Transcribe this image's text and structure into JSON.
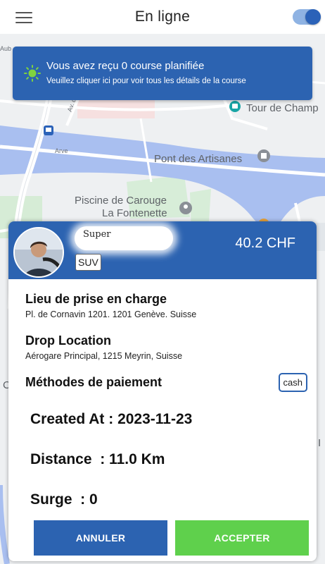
{
  "topbar": {
    "title": "En ligne",
    "online_toggle": true
  },
  "map": {
    "labels": {
      "aub": "Aub",
      "av": "Av. d",
      "arve": "Arve",
      "tour": "Tour de Champ",
      "pont": "Pont des Artisanes",
      "piscine1": "Piscine de Carouge",
      "piscine2": "La Fontenette",
      "cedge": "C",
      "iedge": "I"
    }
  },
  "banner": {
    "title": "Vous avez reçu 0 course planifiée",
    "subtitle": "Veuillez cliquer ici pour voir tous les détails de la course"
  },
  "ride": {
    "driver_name": "Super",
    "vehicle_type": "SUV",
    "price": "40.2 CHF",
    "pickup_title": "Lieu de prise en charge",
    "pickup_address": "Pl. de Cornavin 1201. 1201 Genève. Suisse",
    "drop_title": "Drop Location",
    "drop_address": "Aérogare Principal, 1215 Meyrin, Suisse",
    "payment_title": "Méthodes de paiement",
    "payment_method": "cash",
    "created_at": "Created At : 2023-11-23",
    "distance": "Distance  : 11.0 Km",
    "surge": "Surge  : 0"
  },
  "actions": {
    "cancel_label": "ANNULER",
    "accept_label": "ACCEPTER"
  },
  "colors": {
    "primary": "#2c63b1",
    "accept": "#5fd04c",
    "river": "#a9bff0"
  }
}
